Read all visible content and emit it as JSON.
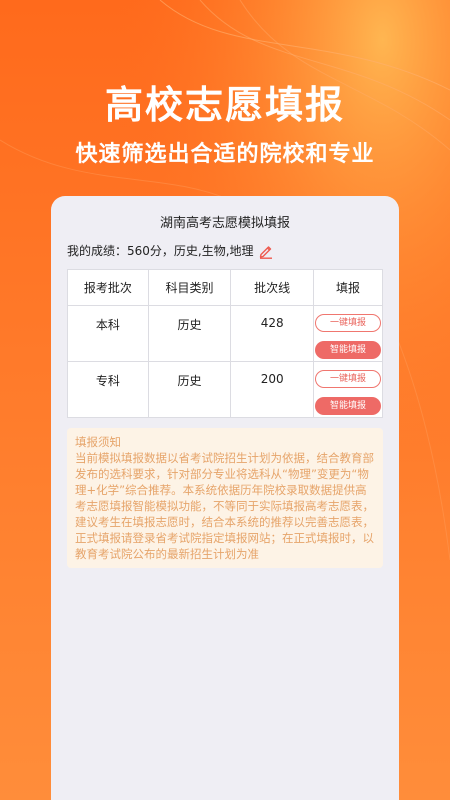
{
  "hero": {
    "title": "高校志愿填报",
    "subtitle": "快速筛选出合适的院校和专业"
  },
  "card": {
    "title": "湖南高考志愿模拟填报",
    "score_line": "我的成绩：560分，历史,生物,地理",
    "edit_icon": "pencil-icon"
  },
  "table": {
    "headers": [
      "报考批次",
      "科目类别",
      "批次线",
      "填报"
    ],
    "rows": [
      {
        "batch": "本科",
        "subject": "历史",
        "line": "428",
        "btn_one": "一键填报",
        "btn_smart": "智能填报"
      },
      {
        "batch": "专科",
        "subject": "历史",
        "line": "200",
        "btn_one": "一键填报",
        "btn_smart": "智能填报"
      }
    ]
  },
  "notice": {
    "title": "填报须知",
    "body": "当前模拟填报数据以省考试院招生计划为依据，结合教育部发布的选科要求，针对部分专业将选科从“物理”变更为“物理+化学”综合推荐。本系统依据历年院校录取数据提供高考志愿填报智能模拟功能，不等同于实际填报高考志愿表，建议考生在填报志愿时，结合本系统的推荐以完善志愿表，正式填报请登录省考试院指定填报网站；在正式填报时，以教育考试院公布的最新招生计划为准"
  },
  "colors": {
    "background": "#ff6a1c",
    "card": "#efeef4",
    "accent": "#ee6a66",
    "notice_bg": "#fdf3e6",
    "notice_text": "#e6a46a"
  }
}
